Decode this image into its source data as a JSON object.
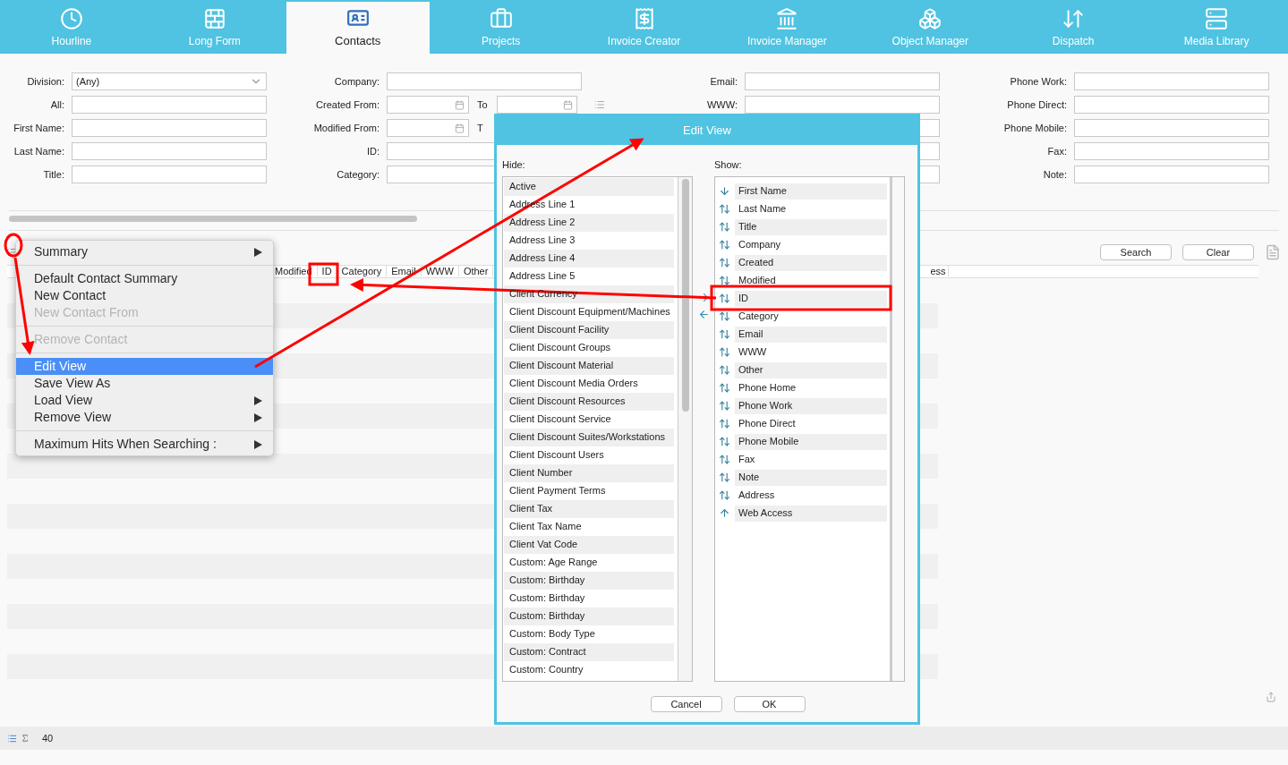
{
  "nav_tabs": [
    {
      "label": "Hourline",
      "selected": false
    },
    {
      "label": "Long Form",
      "selected": false
    },
    {
      "label": "Contacts",
      "selected": true
    },
    {
      "label": "Projects",
      "selected": false
    },
    {
      "label": "Invoice Creator",
      "selected": false
    },
    {
      "label": "Invoice Manager",
      "selected": false
    },
    {
      "label": "Object Manager",
      "selected": false
    },
    {
      "label": "Dispatch",
      "selected": false
    },
    {
      "label": "Media Library",
      "selected": false
    }
  ],
  "search_form": {
    "column_1": [
      {
        "label": "Division:",
        "kind": "dropdown",
        "value": "(Any)"
      },
      {
        "label": "All:",
        "kind": "text"
      },
      {
        "label": "First Name:",
        "kind": "text"
      },
      {
        "label": "Last Name:",
        "kind": "text"
      },
      {
        "label": "Title:",
        "kind": "text"
      }
    ],
    "column_2": [
      {
        "label": "Company:",
        "kind": "text"
      },
      {
        "label": "Created From:",
        "kind": "date",
        "to_label": "To"
      },
      {
        "label": "Modified From:",
        "kind": "date",
        "to_label": "T"
      },
      {
        "label": "ID:",
        "kind": "text"
      },
      {
        "label": "Category:",
        "kind": "text"
      }
    ],
    "column_3": [
      {
        "label": "Email:",
        "kind": "text"
      },
      {
        "label": "WWW:",
        "kind": "text"
      }
    ],
    "column_4": [
      {
        "label": "Phone Work:",
        "kind": "text"
      },
      {
        "label": "Phone Direct:",
        "kind": "text"
      },
      {
        "label": "Phone Mobile:",
        "kind": "text"
      },
      {
        "label": "Fax:",
        "kind": "text"
      },
      {
        "label": "Note:",
        "kind": "text"
      }
    ]
  },
  "buttons": [
    "Search",
    "Clear"
  ],
  "table": {
    "columns": [
      "Modified",
      "ID",
      "Category",
      "Email",
      "WWW",
      "Other"
    ],
    "column_cut": "ess"
  },
  "status_bar": {
    "count": "40"
  },
  "context_menu": [
    [
      {
        "label": "Summary",
        "disabled": false,
        "selected": false,
        "submenu": true
      }
    ],
    [
      {
        "label": "Default Contact Summary",
        "disabled": false,
        "selected": false,
        "submenu": false
      },
      {
        "label": "New Contact",
        "disabled": false,
        "selected": false,
        "submenu": false
      },
      {
        "label": "New Contact From",
        "disabled": true,
        "selected": false,
        "submenu": false
      }
    ],
    [
      {
        "label": "Remove Contact",
        "disabled": true,
        "selected": false,
        "submenu": false
      }
    ],
    [
      {
        "label": "Edit View",
        "disabled": false,
        "selected": true,
        "submenu": false
      },
      {
        "label": "Save View As",
        "disabled": false,
        "selected": false,
        "submenu": false
      },
      {
        "label": "Load View",
        "disabled": false,
        "selected": false,
        "submenu": true
      },
      {
        "label": "Remove View",
        "disabled": false,
        "selected": false,
        "submenu": true
      }
    ],
    [
      {
        "label": "Maximum Hits When Searching :",
        "disabled": false,
        "selected": false,
        "submenu": true
      }
    ]
  ],
  "dialog": {
    "title": "Edit View",
    "hide_label": "Hide:",
    "show_label": "Show:",
    "hide_items": [
      "Active",
      "Address Line 1",
      "Address Line 2",
      "Address Line 3",
      "Address Line 4",
      "Address Line 5",
      "Client Currency",
      "Client Discount Equipment/Machines",
      "Client Discount Facility",
      "Client Discount Groups",
      "Client Discount Material",
      "Client Discount Media Orders",
      "Client Discount Resources",
      "Client Discount Service",
      "Client Discount Suites/Workstations",
      "Client Discount Users",
      "Client Number",
      "Client Payment Terms",
      "Client Tax",
      "Client Tax Name",
      "Client Vat Code",
      "Custom: Age Range",
      "Custom: Birthday",
      "Custom: Birthday",
      "Custom: Birthday",
      "Custom: Body Type",
      "Custom: Contract",
      "Custom: Country"
    ],
    "show_items": [
      "First Name",
      "Last Name",
      "Title",
      "Company",
      "Created",
      "Modified",
      "ID",
      "Category",
      "Email",
      "WWW",
      "Other",
      "Phone Home",
      "Phone Work",
      "Phone Direct",
      "Phone Mobile",
      "Fax",
      "Note",
      "Address",
      "Web Access"
    ],
    "buttons": [
      "Cancel",
      "OK"
    ]
  }
}
